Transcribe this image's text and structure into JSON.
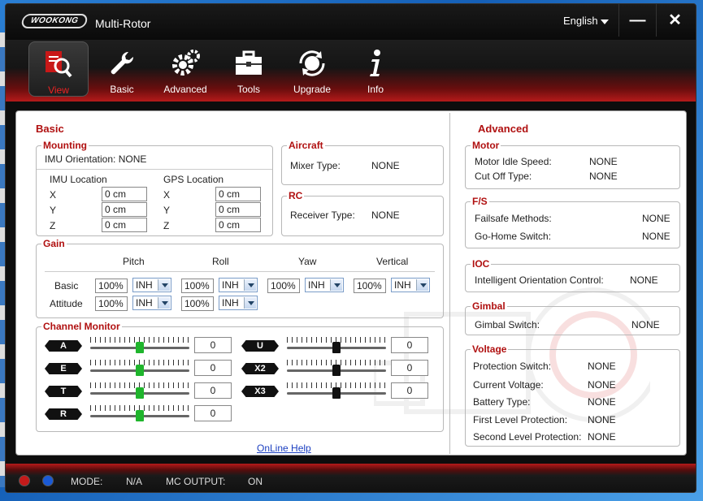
{
  "app": {
    "title": "Multi-Rotor",
    "language": "English",
    "logo_text": "WOOKONG"
  },
  "window_controls": {
    "minimize": "—",
    "close": "✕"
  },
  "toolbar": [
    {
      "label": "View",
      "icon": "view-magnifier-icon"
    },
    {
      "label": "Basic",
      "icon": "wrench-icon"
    },
    {
      "label": "Advanced",
      "icon": "gears-icon"
    },
    {
      "label": "Tools",
      "icon": "toolbox-icon"
    },
    {
      "label": "Upgrade",
      "icon": "globe-refresh-icon"
    },
    {
      "label": "Info",
      "icon": "info-icon"
    }
  ],
  "basic": {
    "title": "Basic",
    "mounting": {
      "title": "Mounting",
      "imu_orientation": "IMU Orientation:  NONE",
      "imu_location": "IMU Location",
      "gps_location": "GPS Location",
      "axes": [
        "X",
        "Y",
        "Z"
      ],
      "imu_values": [
        "0 cm",
        "0 cm",
        "0 cm"
      ],
      "gps_values": [
        "0 cm",
        "0 cm",
        "0 cm"
      ]
    },
    "aircraft": {
      "title": "Aircraft",
      "label": "Mixer Type:",
      "value": "NONE"
    },
    "rc": {
      "title": "RC",
      "label": "Receiver Type:",
      "value": "NONE"
    },
    "gain": {
      "title": "Gain",
      "columns": [
        "Pitch",
        "Roll",
        "Yaw",
        "Vertical"
      ],
      "row_basic": "Basic",
      "row_attitude": "Attitude",
      "basic": [
        {
          "value": "100%",
          "mode": "INH"
        },
        {
          "value": "100%",
          "mode": "INH"
        },
        {
          "value": "100%",
          "mode": "INH"
        },
        {
          "value": "100%",
          "mode": "INH"
        }
      ],
      "attitude": [
        {
          "value": "100%",
          "mode": "INH"
        },
        {
          "value": "100%",
          "mode": "INH"
        }
      ]
    },
    "channel_monitor": {
      "title": "Channel Monitor",
      "left": [
        {
          "name": "A",
          "value": "0",
          "level": 0.5
        },
        {
          "name": "E",
          "value": "0",
          "level": 0.5
        },
        {
          "name": "T",
          "value": "0",
          "level": 0.5
        },
        {
          "name": "R",
          "value": "0",
          "level": 0.5
        }
      ],
      "right": [
        {
          "name": "U",
          "value": "0",
          "level": 0.5
        },
        {
          "name": "X2",
          "value": "0",
          "level": 0.5
        },
        {
          "name": "X3",
          "value": "0",
          "level": 0.5
        }
      ],
      "left_thumb_color": "#1fb52c",
      "right_thumb_color": "#111111"
    },
    "help_link": "OnLine Help"
  },
  "advanced": {
    "title": "Advanced",
    "motor": {
      "title": "Motor",
      "rows": [
        {
          "label": "Motor Idle Speed:",
          "value": "NONE"
        },
        {
          "label": "Cut Off Type:",
          "value": "NONE"
        }
      ]
    },
    "fs": {
      "title": "F/S",
      "rows": [
        {
          "label": "Failsafe Methods:",
          "value": "NONE"
        },
        {
          "label": "Go-Home Switch:",
          "value": "NONE"
        }
      ]
    },
    "ioc": {
      "title": "IOC",
      "rows": [
        {
          "label": "Intelligent Orientation Control:",
          "value": "NONE"
        }
      ]
    },
    "gimbal": {
      "title": "Gimbal",
      "rows": [
        {
          "label": "Gimbal Switch:",
          "value": "NONE"
        }
      ]
    },
    "voltage": {
      "title": "Voltage",
      "rows": [
        {
          "label": "Protection Switch:",
          "value": "NONE"
        },
        {
          "label": "Current Voltage:",
          "value": "NONE"
        },
        {
          "label": "Battery Type:",
          "value": "NONE"
        },
        {
          "label": "First Level Protection:",
          "value": "NONE"
        },
        {
          "label": "Second Level Protection:",
          "value": "NONE"
        }
      ]
    }
  },
  "status": {
    "mode_label": "MODE:",
    "mode_value": "N/A",
    "output_label": "MC OUTPUT:",
    "output_value": "ON",
    "led1_color": "#c41a1a",
    "led2_color": "#1a5ad6"
  },
  "colors": {
    "accent": "#b01010"
  }
}
